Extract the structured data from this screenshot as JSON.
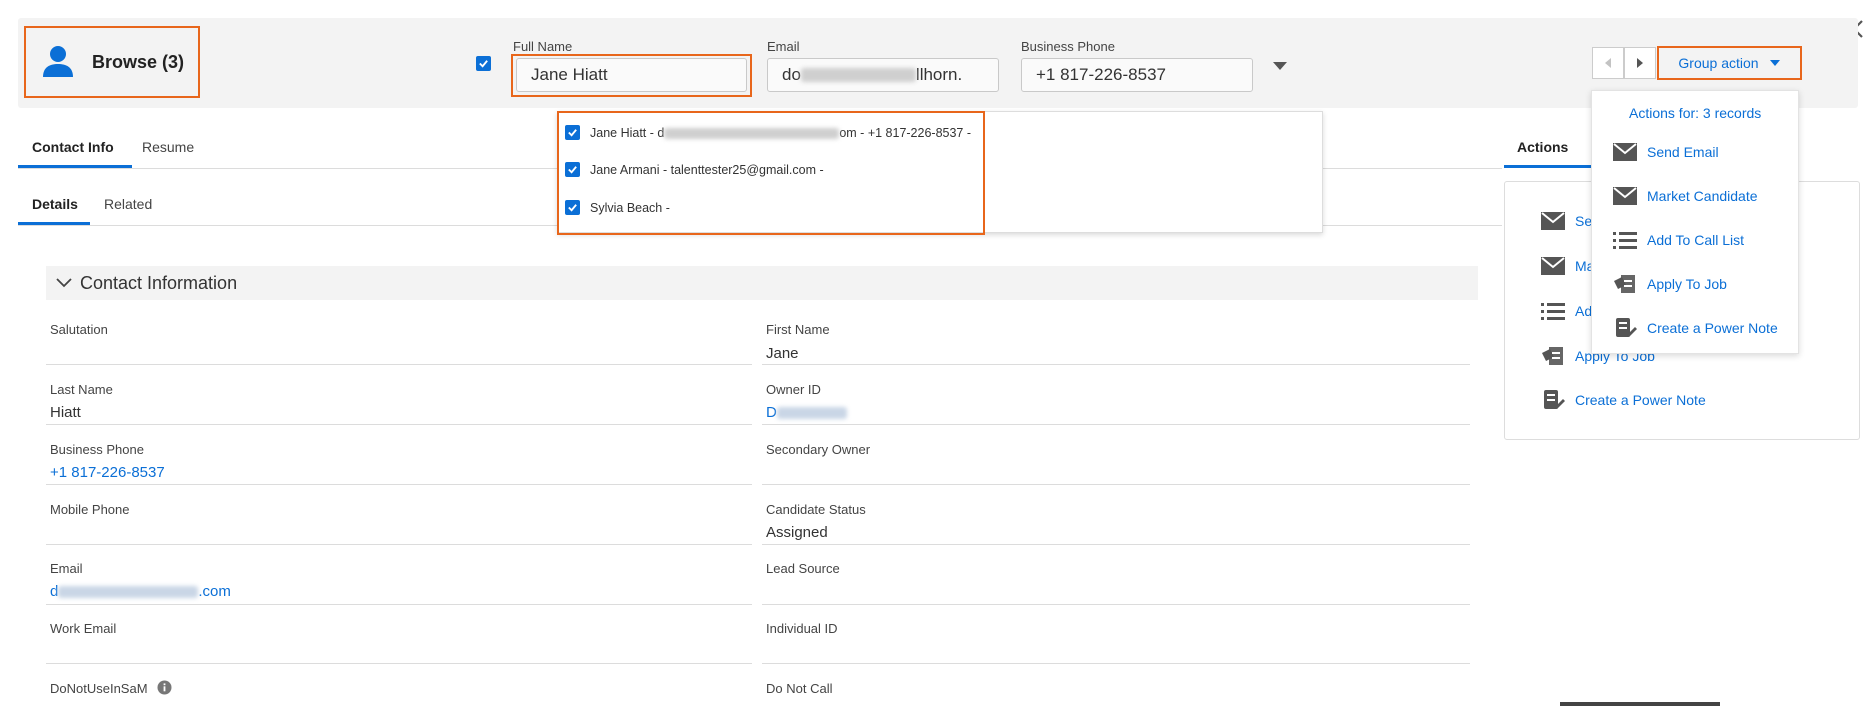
{
  "header": {
    "browse_title": "Browse (3)",
    "fields": {
      "full_name_label": "Full Name",
      "full_name_value": "Jane Hiatt",
      "email_label": "Email",
      "email_value_start": "do",
      "email_value_end": "llhorn.",
      "phone_label": "Business Phone",
      "phone_value": "+1 817-226-8537"
    },
    "group_action_label": "Group action"
  },
  "records_dropdown": [
    {
      "text_start": "Jane Hiatt - d",
      "text_end": "om - +1 817-226-8537 -"
    },
    {
      "text_start": "Jane Armani - talenttester25@gmail.com -",
      "text_end": ""
    },
    {
      "text_start": "Sylvia Beach -",
      "text_end": ""
    }
  ],
  "tabs": {
    "primary": [
      "Contact Info",
      "Resume"
    ],
    "secondary": [
      "Details",
      "Related"
    ],
    "actions_tab": "Actions"
  },
  "group_action_menu": {
    "title": "Actions for: 3 records",
    "items": [
      "Send Email",
      "Market Candidate",
      "Add To Call List",
      "Apply To Job",
      "Create a Power Note"
    ]
  },
  "actions_panel": {
    "items": [
      "Se",
      "Ma",
      "Ad",
      "Apply To Job",
      "Create a Power Note"
    ]
  },
  "contact_section": {
    "title": "Contact Information",
    "fields": [
      {
        "label": "Salutation",
        "value": ""
      },
      {
        "label": "First Name",
        "value": "Jane"
      },
      {
        "label": "Last Name",
        "value": "Hiatt"
      },
      {
        "label": "Owner ID",
        "value": "D"
      },
      {
        "label": "Business Phone",
        "value": "+1 817-226-8537"
      },
      {
        "label": "Secondary Owner",
        "value": ""
      },
      {
        "label": "Mobile Phone",
        "value": ""
      },
      {
        "label": "Candidate Status",
        "value": "Assigned"
      },
      {
        "label": "Email",
        "value_start": "d",
        "value_end": ".com"
      },
      {
        "label": "Lead Source",
        "value": ""
      },
      {
        "label": "Work Email",
        "value": ""
      },
      {
        "label": "Individual ID",
        "value": ""
      },
      {
        "label": "DoNotUseInSaM",
        "value": ""
      },
      {
        "label": "Do Not Call",
        "value": ""
      }
    ]
  },
  "colors": {
    "accent": "#0b6fd6",
    "highlight": "#e8661b"
  },
  "icons": [
    "user-icon",
    "checkbox-icon",
    "dropdown-arrow-icon",
    "prev-icon",
    "next-icon",
    "mail-icon",
    "list-icon",
    "apply-job-icon",
    "power-note-icon",
    "info-icon",
    "close-icon",
    "chevron-down-icon"
  ]
}
